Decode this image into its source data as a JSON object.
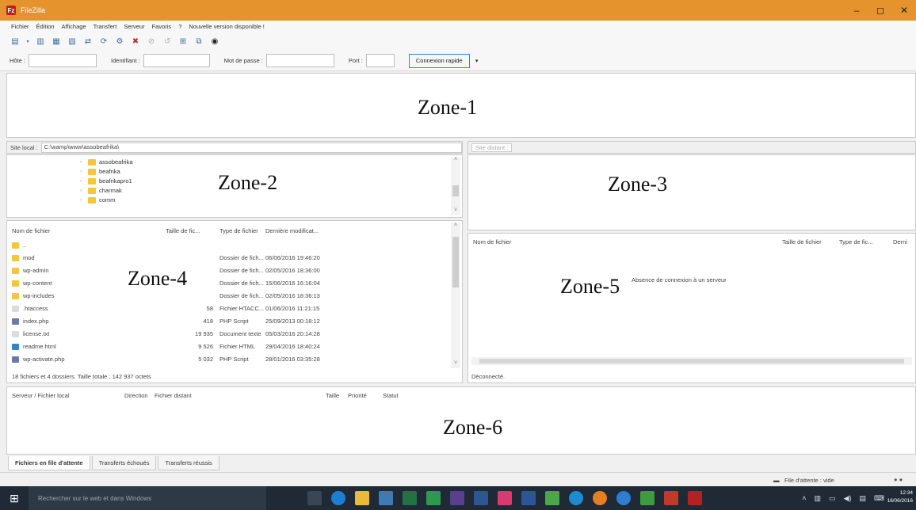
{
  "window": {
    "title": "FileZilla",
    "controls": [
      "–",
      "◻",
      "✕"
    ]
  },
  "menu": [
    "Fichier",
    "Édition",
    "Affichage",
    "Transfert",
    "Serveur",
    "Favoris",
    "?",
    "Nouvelle version disponible !"
  ],
  "quickconnect": {
    "host_label": "Hôte :",
    "user_label": "Identifiant :",
    "pass_label": "Mot de passe :",
    "port_label": "Port :",
    "connect_button": "Connexion rapide",
    "dropdown_arrow": "▾"
  },
  "zones": {
    "zone1": "Zone-1",
    "zone2": "Zone-2",
    "zone3": "Zone-3",
    "zone4": "Zone-4",
    "zone5": "Zone-5",
    "zone6": "Zone-6"
  },
  "local_site": {
    "label": "Site local :",
    "path": "C:\\wamp\\www\\assobeafrika\\",
    "tree": [
      "assobeafrika",
      "beafrika",
      "beafrikapro1",
      "charmak",
      "comm"
    ]
  },
  "remote_site": {
    "label": "Site distant :"
  },
  "local_files": {
    "columns": [
      "Nom de fichier",
      "Taille de fic...",
      "Type de fichier",
      "Dernière modificat..."
    ],
    "rows": [
      {
        "name": "..",
        "size": "",
        "type": "",
        "date": "",
        "icon": "folder"
      },
      {
        "name": "mod",
        "size": "",
        "type": "Dossier de fich...",
        "date": "06/06/2016 19:46:20",
        "icon": "folder"
      },
      {
        "name": "wp-admin",
        "size": "",
        "type": "Dossier de fich...",
        "date": "02/05/2016 18:36:00",
        "icon": "folder"
      },
      {
        "name": "wp-content",
        "size": "",
        "type": "Dossier de fich...",
        "date": "15/06/2016 16:16:04",
        "icon": "folder"
      },
      {
        "name": "wp-includes",
        "size": "",
        "type": "Dossier de fich...",
        "date": "02/05/2016 18:36:13",
        "icon": "folder"
      },
      {
        "name": ".htaccess",
        "size": "58",
        "type": "Fichier HTACC...",
        "date": "01/06/2016 11:21:15",
        "icon": "file"
      },
      {
        "name": "index.php",
        "size": "418",
        "type": "PHP Script",
        "date": "25/09/2013 00:18:12",
        "icon": "php"
      },
      {
        "name": "license.txt",
        "size": "19 935",
        "type": "Document texte",
        "date": "05/03/2016 20:14:28",
        "icon": "file"
      },
      {
        "name": "readme.html",
        "size": "9 526",
        "type": "Fichier HTML",
        "date": "29/04/2016 18:40:24",
        "icon": "html"
      },
      {
        "name": "wp-activate.php",
        "size": "5 032",
        "type": "PHP Script",
        "date": "28/01/2016 03:35:28",
        "icon": "php"
      }
    ],
    "summary": "18 fichiers et 4 dossiers. Taille totale : 142 937 octets"
  },
  "remote_files": {
    "columns": [
      "Nom de fichier",
      "Taille de fichier",
      "Type de fic...",
      "Derni"
    ],
    "empty_message": "Absence de connexion à un serveur",
    "status": "Déconnecté."
  },
  "queue": {
    "columns": [
      "Serveur / Fichier local",
      "Direction",
      "Fichier distant",
      "Taille",
      "Priorité",
      "Statut"
    ],
    "tabs": [
      "Fichiers en file d'attente",
      "Transferts échoués",
      "Transferts réussis"
    ],
    "status_text": "File d'attente : vide"
  },
  "taskbar": {
    "search_placeholder": "Rechercher sur le web et dans Windows",
    "time": "12:34",
    "date": "16/06/2016"
  }
}
